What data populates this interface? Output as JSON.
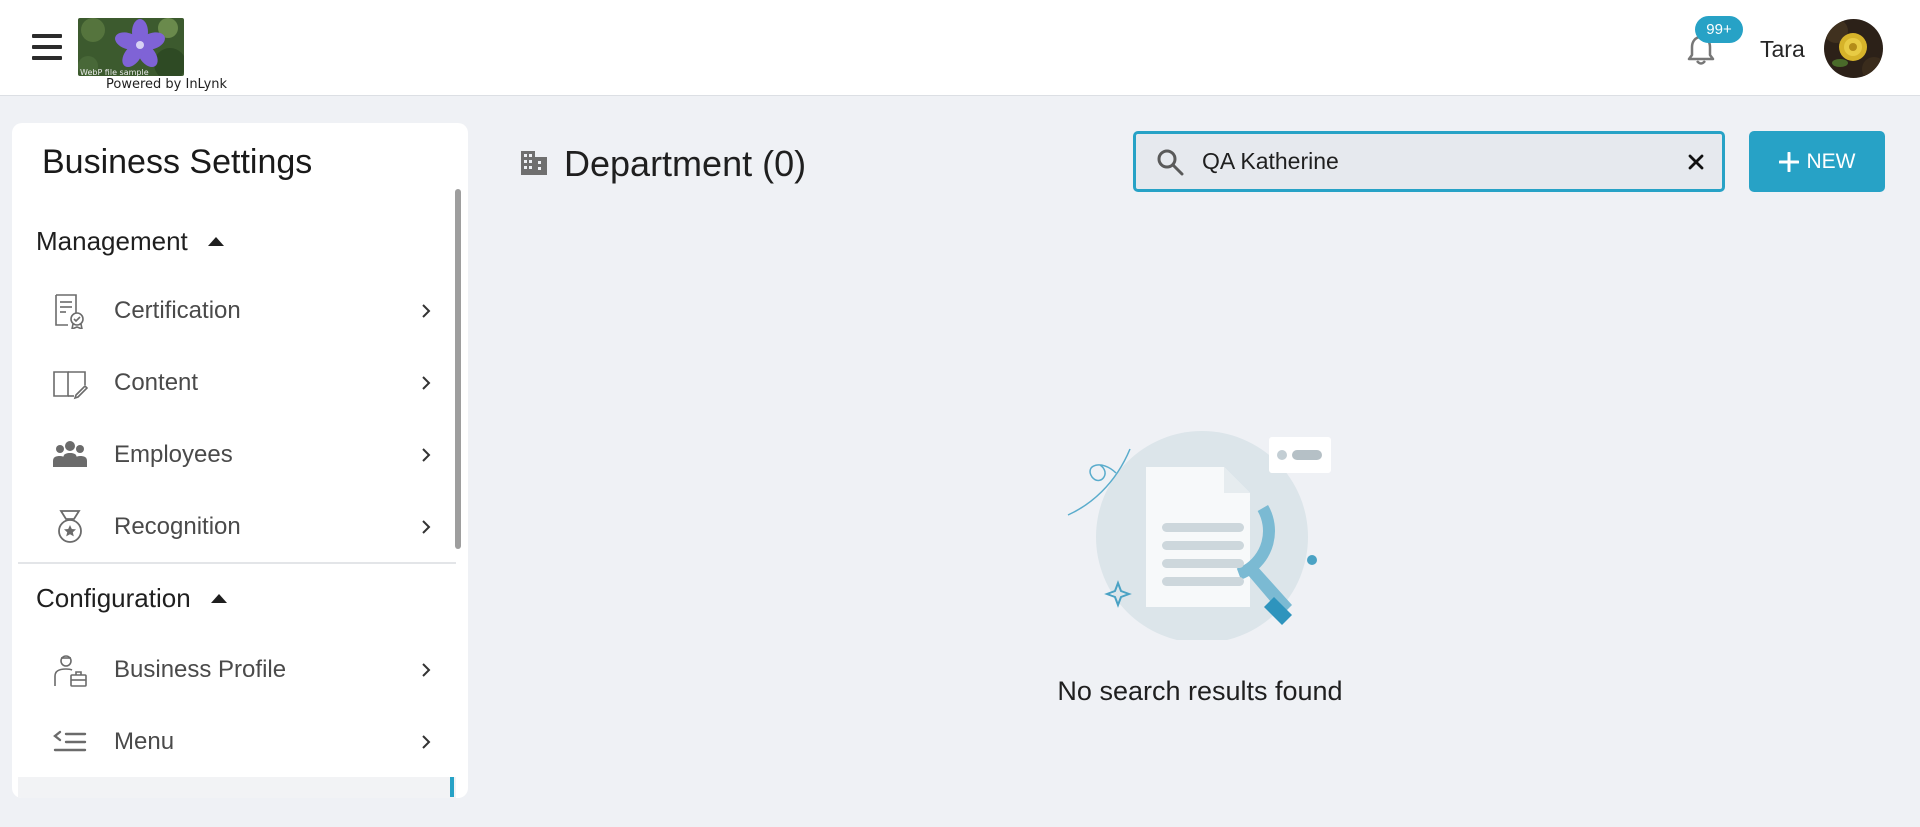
{
  "header": {
    "menu_icon": "hamburger-icon",
    "logo_caption": "WebP file sample",
    "powered_by": "Powered by InLynk",
    "notification_badge": "99+",
    "notification_icon": "bell-icon",
    "username": "Tara"
  },
  "sidebar": {
    "title": "Business Settings",
    "sections": [
      {
        "label": "Management",
        "items": [
          {
            "label": "Certification",
            "icon": "certificate-icon"
          },
          {
            "label": "Content",
            "icon": "book-edit-icon"
          },
          {
            "label": "Employees",
            "icon": "group-icon"
          },
          {
            "label": "Recognition",
            "icon": "medal-icon"
          }
        ]
      },
      {
        "label": "Configuration",
        "items": [
          {
            "label": "Business Profile",
            "icon": "business-profile-icon"
          },
          {
            "label": "Menu",
            "icon": "menu-list-icon"
          }
        ]
      }
    ]
  },
  "main": {
    "title": "Department (0)",
    "title_icon": "building-icon",
    "search": {
      "value": "QA Katherine",
      "placeholder": "Search"
    },
    "new_button": "NEW",
    "empty_message": "No search results found"
  },
  "colors": {
    "accent": "#27a2c6",
    "background": "#eff1f5"
  }
}
